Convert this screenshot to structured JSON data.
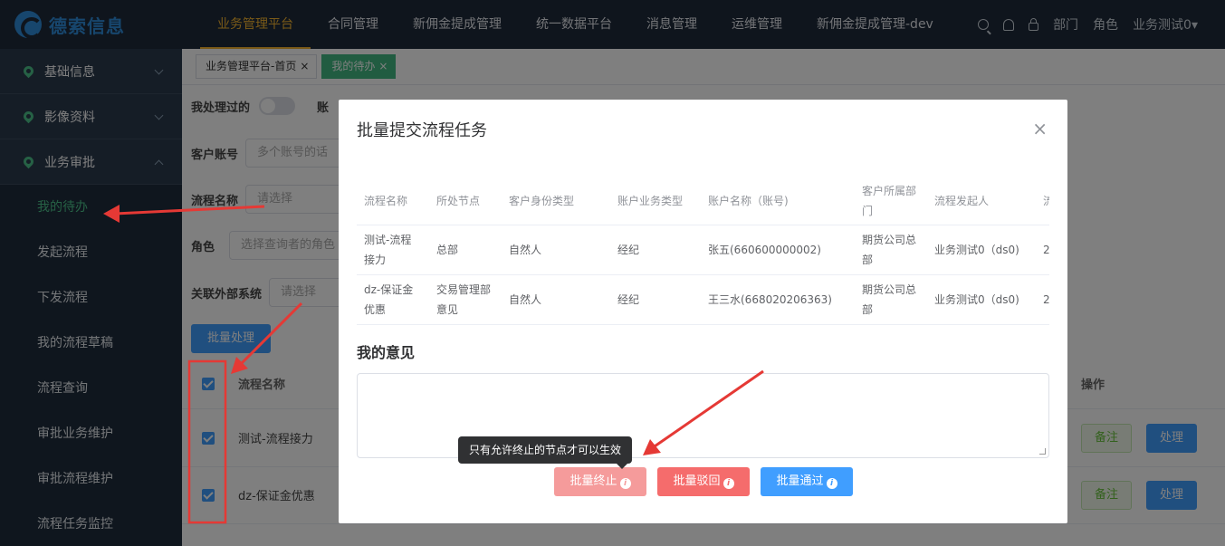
{
  "brand": {
    "name": "德索信息"
  },
  "topnav": [
    {
      "label": "业务管理平台",
      "active": true
    },
    {
      "label": "合同管理"
    },
    {
      "label": "新佣金提成管理"
    },
    {
      "label": "统一数据平台"
    },
    {
      "label": "消息管理"
    },
    {
      "label": "运维管理"
    },
    {
      "label": "新佣金提成管理-dev"
    }
  ],
  "topright": {
    "dept": "部门",
    "role": "角色",
    "user": "业务测试0▾"
  },
  "sidebar": {
    "groups": [
      {
        "label": "基础信息",
        "expanded": false
      },
      {
        "label": "影像资料",
        "expanded": false
      },
      {
        "label": "业务审批",
        "expanded": true
      }
    ],
    "items": [
      "我的待办",
      "发起流程",
      "下发流程",
      "我的流程草稿",
      "流程查询",
      "审批业务维护",
      "审批流程维护",
      "流程任务监控"
    ]
  },
  "tabs": [
    {
      "label": "业务管理平台-首页",
      "close": "×"
    },
    {
      "label": "我的待办",
      "close": "×",
      "active": true
    }
  ],
  "filters": {
    "handled": "我处理过的",
    "account_trunc": "账",
    "account": "客户账号",
    "account_placeholder": "多个账号的话",
    "flow": "流程名称",
    "flow_placeholder": "请选择",
    "role": "角色",
    "role_placeholder": "选择查询者的角色",
    "ext": "关联外部系统",
    "ext_placeholder": "请选择"
  },
  "list": {
    "batch_button": "批量处理",
    "header_name": "流程名称",
    "header_ops": "操作",
    "rows": [
      "测试-流程接力",
      "dz-保证金优惠"
    ],
    "note_button": "备注",
    "handle_button": "处理"
  },
  "modal": {
    "title": "批量提交流程任务",
    "close": "×",
    "columns": [
      "流程名称",
      "所处节点",
      "客户身份类型",
      "账户业务类型",
      "账户名称（账号)",
      "客户所属部门",
      "流程发起人",
      "流"
    ],
    "rows": [
      [
        "测试-流程接力",
        "总部",
        "自然人",
        "经纪",
        "张五(660600000002)",
        "期货公司总部",
        "业务测试0（ds0)",
        "2"
      ],
      [
        "dz-保证金优惠",
        "交易管理部意见",
        "自然人",
        "经纪",
        "王三水(668020206363)",
        "期货公司总部",
        "业务测试0（ds0)",
        "2"
      ]
    ],
    "opinion_label": "我的意见",
    "buttons": {
      "terminate": "批量终止",
      "reject": "批量驳回",
      "approve": "批量通过"
    },
    "tooltip": "只有允许终止的节点才可以生效",
    "colors": {
      "terminate": "#f59b9b",
      "reject": "#f56c6c",
      "approve": "#409eff"
    }
  },
  "annotation_color": "#e53935"
}
